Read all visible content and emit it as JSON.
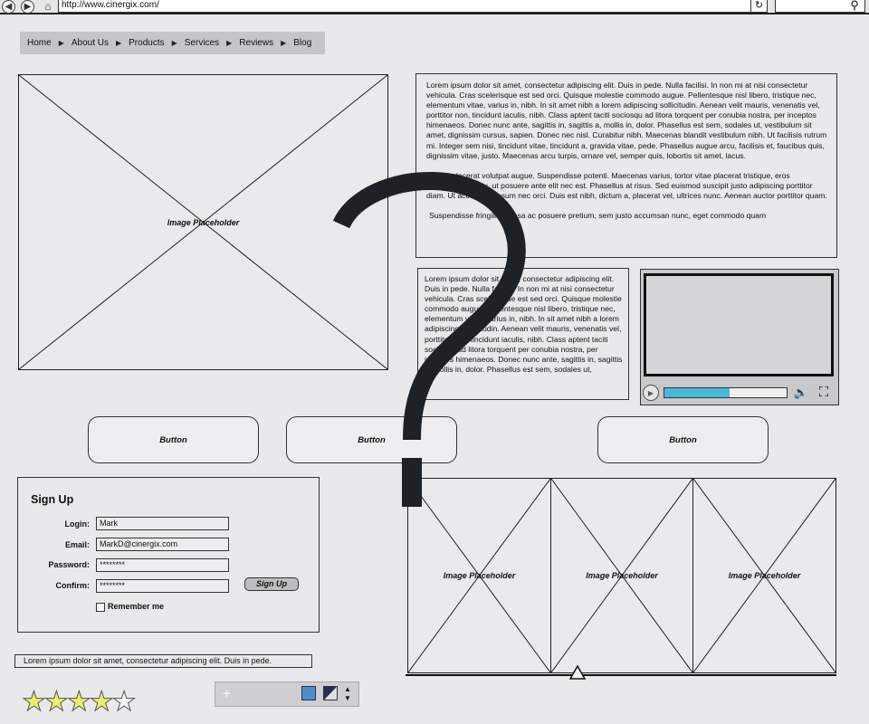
{
  "browser": {
    "url": "http://www.cinergix.com/"
  },
  "menu": {
    "items": [
      "Home",
      "About Us",
      "Products",
      "Services",
      "Reviews",
      "Blog"
    ]
  },
  "placeholders": {
    "main_label": "Image Placeholder",
    "gallery": [
      "Image Placeholder",
      "Image Placeholder",
      "Image Placeholder"
    ]
  },
  "text_main": {
    "paragraphs": [
      "Lorem ipsum dolor sit amet, consectetur adipiscing elit. Duis in pede. Nulla facilisi. In non mi at nisi consectetur vehicula. Cras scelerisque est sed orci. Quisque molestie commodo augue. Pellentesque nisl libero, tristique nec, elementum vitae, varius in, nibh. In sit amet nibh a lorem adipiscing sollicitudin. Aenean velit mauris, venenatis vel, porttitor non, tincidunt iaculis, nibh. Class aptent taciti sociosqu ad litora torquent per conubia nostra, per inceptos himenaeos. Donec nunc ante, sagittis in, sagittis a, mollis in, dolor. Phasellus est sem, sodales ut, vestibulum sit amet, dignissim cursus, sapien. Donec nec nisl. Curabitur nibh. Maecenas blandit vestibulum nibh. Ut facilisis rutrum mi. Integer sem nisi, tincidunt vitae, tincidunt a, gravida vitae, pede. Phasellus augue arcu, facilisis et, faucibus quis, dignissim vitae, justo. Maecenas arcu turpis, ornare vel, semper quis, lobortis sit amet, lacus.",
      "Mauris placerat volutpat augue. Suspendisse potenti. Maecenas varius, tortor vitae placerat tristique, eros pellentesque arcu, ut posuere ante elit nec est. Phasellus at risus. Sed euismod suscipit justo adipiscing porttitor diam. Ut accumsan ipsum nec orci. Duis est nibh, dictum a, placerat vel, ultrices nunc. Aenean auctor porttitor quam.",
      "Suspendisse fringilla massa ac posuere pretium, sem justo accumsan nunc, eget commodo quam"
    ]
  },
  "text_side": {
    "body": "Lorem ipsum dolor sit amet, consectetur adipiscing elit. Duis in pede. Nulla facilisi. In non mi at nisi consectetur vehicula. Cras scelerisque est sed orci. Quisque molestie commodo augue. Pellentesque nisl libero, tristique nec, elementum vitae, varius in, nibh. In sit amet nibh a lorem adipiscing sollicitudin. Aenean velit mauris, venenatis vel, porttitor non, tincidunt iaculis, nibh. Class aptent taciti sociosqu ad litora torquent per conubia nostra, per inceptos himenaeos. Donec nunc ante, sagittis in, sagittis a, mollis in, dolor. Phasellus est sem, sodales ut,"
  },
  "video": {
    "progress": 0.53,
    "progress_color": "#49b7dc"
  },
  "buttons": [
    "Button",
    "Button",
    "Button"
  ],
  "signup": {
    "title": "Sign Up",
    "login_label": "Login:",
    "login_value": "Mark",
    "email_label": "Email:",
    "email_value": "MarkD@cinergix.com",
    "password_label": "Password:",
    "password_value": "********",
    "confirm_label": "Confirm:",
    "confirm_value": "********",
    "submit_label": "Sign Up",
    "remember_label": "Remember me"
  },
  "footer": {
    "text": "Lorem ipsum dolor sit amet, consectetur adipiscing elit. Duis in pede."
  },
  "rating": {
    "value": 4,
    "max": 5,
    "filled_color": "#e9ee6b"
  },
  "icons": {
    "back": "back-arrow-icon",
    "forward": "forward-arrow-icon",
    "home": "home-icon",
    "refresh": "refresh-icon",
    "search": "search-icon",
    "volume": "volume-icon",
    "fullscreen": "fullscreen-icon"
  }
}
